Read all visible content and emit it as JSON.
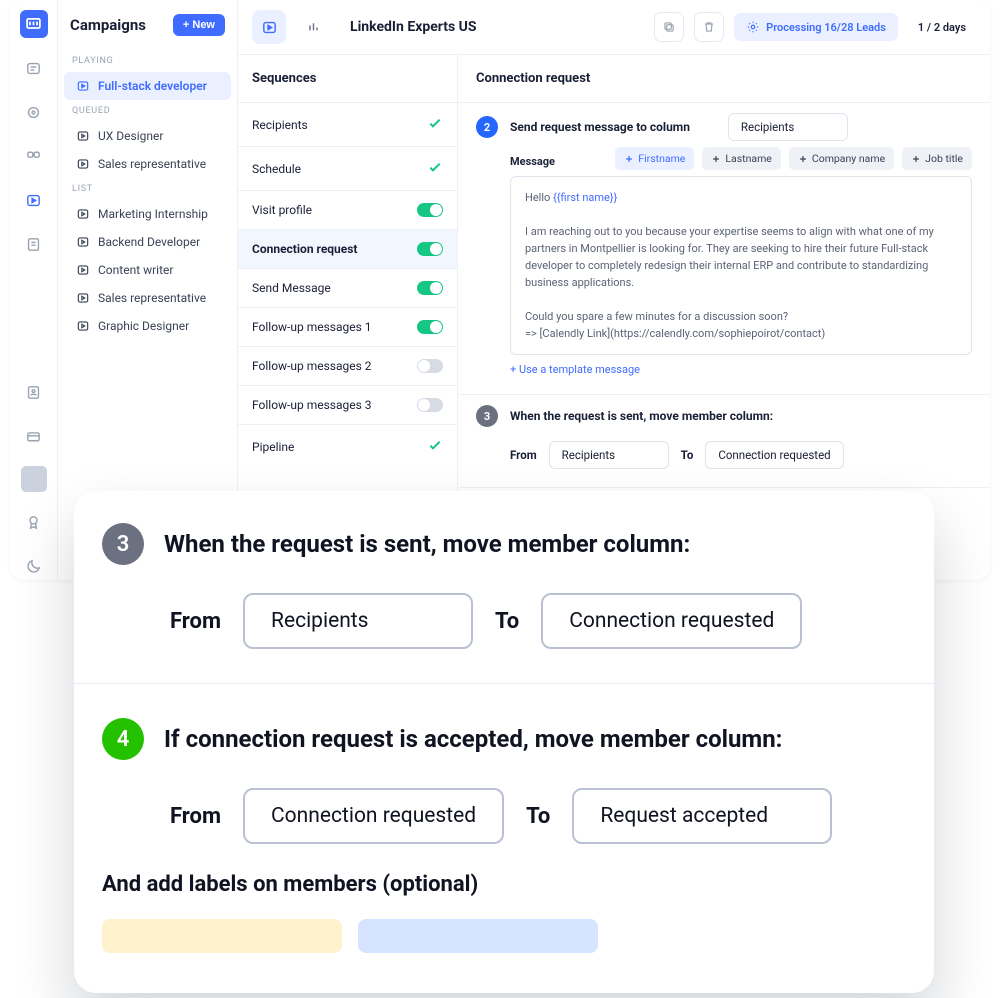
{
  "sidebar": {
    "title": "Campaigns",
    "new_label": "+ New",
    "groups": {
      "playing": {
        "label": "PLAYING",
        "items": [
          "Full-stack developer"
        ]
      },
      "queued": {
        "label": "QUEUED",
        "items": [
          "UX Designer",
          "Sales representative"
        ]
      },
      "list": {
        "label": "LIST",
        "items": [
          "Marketing Internship",
          "Backend Developer",
          "Content writer",
          "Sales representative",
          "Graphic Designer"
        ]
      }
    }
  },
  "topbar": {
    "title": "LinkedIn Experts US",
    "processing": "Processing 16/28 Leads",
    "days": "1 / 2 days"
  },
  "sequences": {
    "heading": "Sequences",
    "items": [
      {
        "label": "Recipients",
        "status": "check"
      },
      {
        "label": "Schedule",
        "status": "check"
      },
      {
        "label": "Visit profile",
        "status": "on"
      },
      {
        "label": "Connection request",
        "status": "on",
        "active": true
      },
      {
        "label": "Send Message",
        "status": "on"
      },
      {
        "label": "Follow-up messages 1",
        "status": "on"
      },
      {
        "label": "Follow-up messages 2",
        "status": "off"
      },
      {
        "label": "Follow-up messages 3",
        "status": "off"
      },
      {
        "label": "Pipeline",
        "status": "check"
      }
    ]
  },
  "detail": {
    "heading": "Connection request",
    "step2": {
      "title": "Send request message to column",
      "column": "Recipients",
      "message_label": "Message",
      "chips": [
        "Firstname",
        "Lastname",
        "Company name",
        "Job title"
      ],
      "msg_line1a": "Hello ",
      "msg_line1b": "{{first name}}",
      "msg_body": "I am reaching out to you because your expertise seems to align with what one of my partners in Montpellier is looking for. They are seeking to hire their future Full-stack developer to completely redesign their internal ERP and contribute to standardizing business applications.",
      "msg_foot1": "Could you spare a few minutes for a discussion soon?",
      "msg_foot2": "=> [Calendly Link](https://calendly.com/sophiepoirot/contact)",
      "template_link": "+ Use a template message"
    },
    "step3": {
      "title": "When the request is sent, move member column:",
      "from_label": "From",
      "from_value": "Recipients",
      "to_label": "To",
      "to_value": "Connection requested"
    },
    "step4": {
      "title": "If connection request is accepted, move member column:"
    }
  },
  "zoom": {
    "step3": {
      "num": "3",
      "title": "When the request is sent, move member column:",
      "from_label": "From",
      "from_value": "Recipients",
      "to_label": "To",
      "to_value": "Connection requested"
    },
    "step4": {
      "num": "4",
      "title": "If connection request is accepted, move member column:",
      "from_label": "From",
      "from_value": "Connection requested",
      "to_label": "To",
      "to_value": "Request accepted",
      "labels_title": "And add labels on members (optional)"
    }
  }
}
